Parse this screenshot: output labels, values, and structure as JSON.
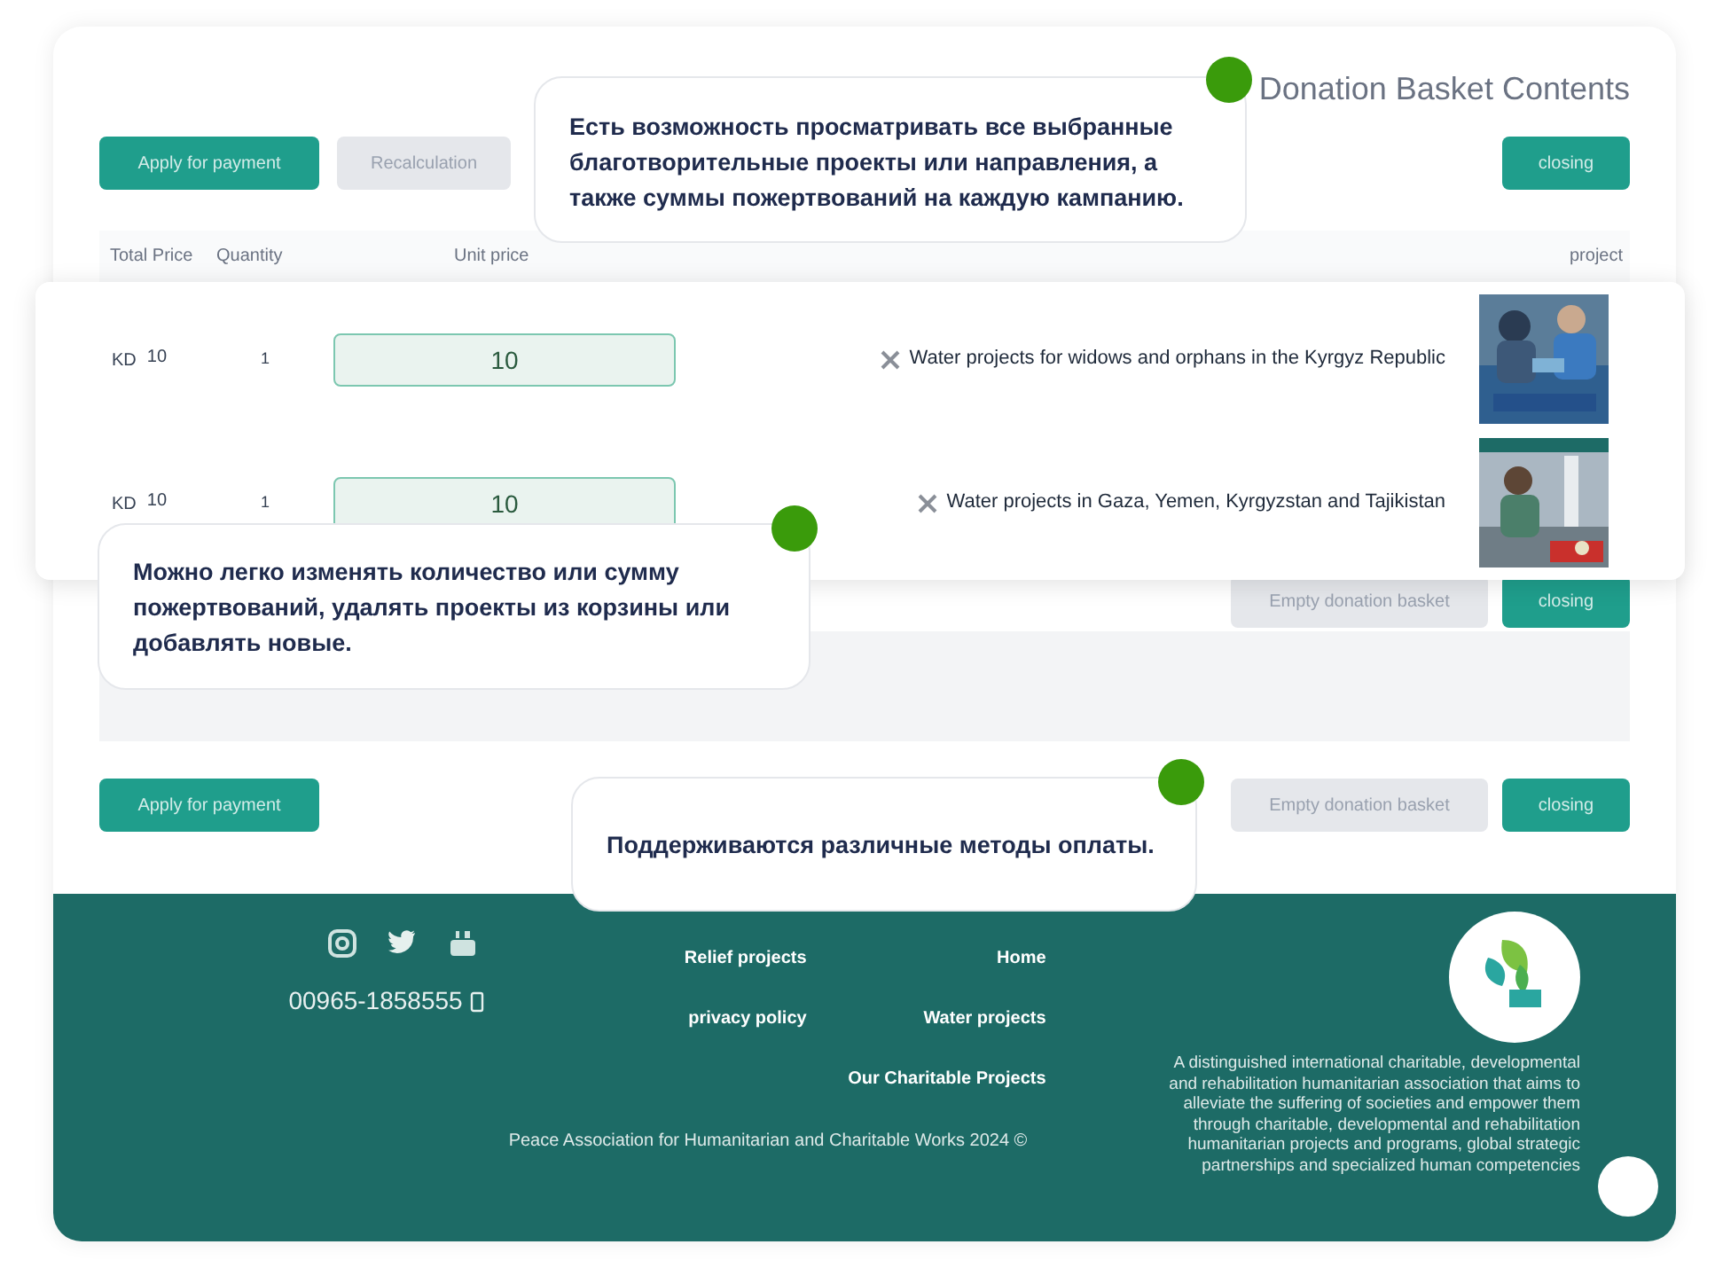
{
  "title": "Donation Basket Contents",
  "toolbar_top": {
    "start": [
      {
        "label": "Apply for payment",
        "kind": "primary"
      },
      {
        "label": "Recalculation",
        "kind": "secondary"
      }
    ],
    "end": [
      {
        "label": "closing",
        "kind": "primary"
      }
    ]
  },
  "table": {
    "columns": [
      "Total Price",
      "Quantity",
      "Unit price",
      "project"
    ],
    "rows": [
      {
        "currency": "KD",
        "total": "10",
        "quantity": "1",
        "unit_price": "10",
        "project": "Water projects for widows and orphans in the Kyrgyz Republic"
      },
      {
        "currency": "KD",
        "total": "10",
        "quantity": "1",
        "unit_price": "10",
        "project": "Water projects in Gaza, Yemen, Kyrgyzstan and Tajikistan"
      }
    ]
  },
  "toolbar_middle": {
    "end": [
      {
        "label": "Empty donation basket",
        "kind": "secondary"
      },
      {
        "label": "closing",
        "kind": "primary"
      }
    ]
  },
  "toolbar_bottom": {
    "start": [
      {
        "label": "Apply for payment",
        "kind": "primary"
      }
    ],
    "end": [
      {
        "label": "Empty donation basket",
        "kind": "secondary"
      },
      {
        "label": "closing",
        "kind": "primary"
      }
    ]
  },
  "callouts": [
    {
      "text": "Есть возможность просматривать все выбранные благотворительные проекты или направления, а также суммы пожертвований на каждую кампанию."
    },
    {
      "text": "Можно легко изменять количество или сумму пожертвований, удалять проекты из корзины или добавлять новые."
    },
    {
      "text": "Поддерживаются различные методы оплаты."
    }
  ],
  "footer": {
    "phone": "00965-1858555",
    "links": [
      "Relief projects",
      "Home",
      "privacy policy",
      "Water projects",
      "Our Charitable Projects"
    ],
    "copyright": "Peace Association for Humanitarian and Charitable Works 2024 ©",
    "description": "A distinguished international charitable, developmental and rehabilitation humanitarian association that aims to alleviate the suffering of societies and empower them through charitable, developmental and rehabilitation humanitarian projects and programs, global strategic partnerships and specialized human competencies"
  }
}
